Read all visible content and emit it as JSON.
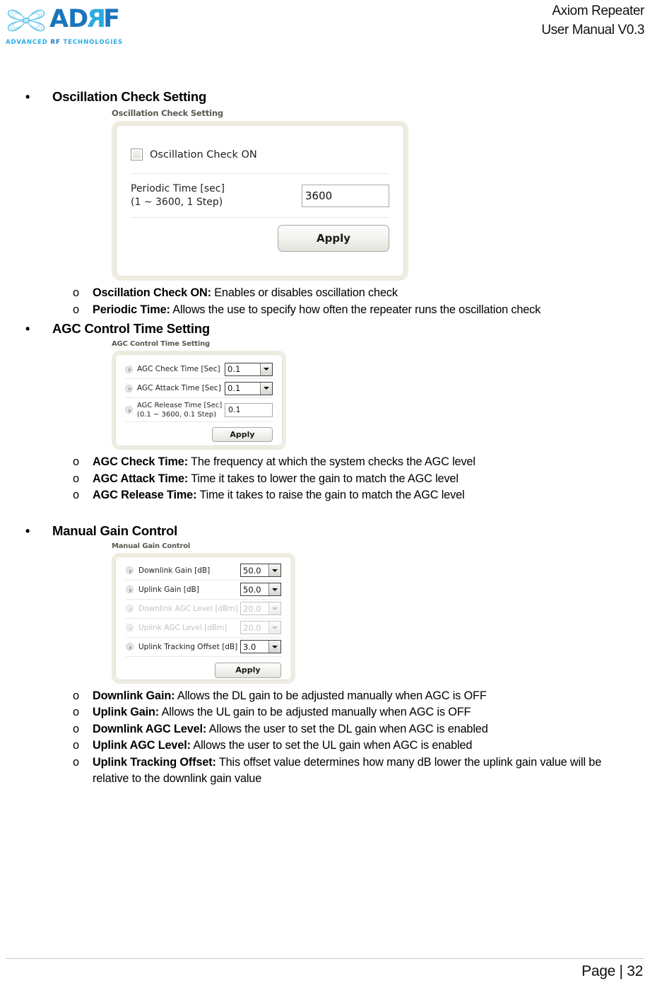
{
  "header": {
    "logo_word_1": "AD",
    "logo_word_r": "R",
    "logo_word_f": "F",
    "logo_tagline_1": "ADVANCED ",
    "logo_tagline_rf": "RF",
    "logo_tagline_2": " TECHNOLOGIES",
    "title_line1": "Axiom Repeater",
    "title_line2": "User Manual V0.3"
  },
  "sections": [
    {
      "heading": "Oscillation Check Setting",
      "bullet": "•",
      "panel": {
        "title": "Oscillation Check Setting",
        "checkbox_label": "Oscillation Check ON",
        "field_label_line1": "Periodic Time [sec]",
        "field_label_line2": "(1 ~ 3600, 1 Step)",
        "field_value": "3600",
        "apply_label": "Apply"
      },
      "items": [
        {
          "marker": "o",
          "term": "Oscillation Check ON:",
          "desc": " Enables or disables oscillation check"
        },
        {
          "marker": "o",
          "term": "Periodic Time:",
          "desc": " Allows the use to specify how often the repeater runs the oscillation check"
        }
      ]
    },
    {
      "heading": "AGC Control Time Setting",
      "bullet": "•",
      "panel": {
        "title": "AGC Control Time Setting",
        "rows": [
          {
            "label": "AGC Check Time [Sec]",
            "value": "0.1",
            "control": "select",
            "disabled": false
          },
          {
            "label": "AGC Attack Time [Sec]",
            "value": "0.1",
            "control": "select",
            "disabled": false
          },
          {
            "label_line1": "AGC Release Time [Sec]",
            "label_line2": "(0.1 ~ 3600, 0.1 Step)",
            "value": "0.1",
            "control": "input",
            "disabled": false
          }
        ],
        "apply_label": "Apply"
      },
      "items": [
        {
          "marker": "o",
          "term": "AGC Check Time:",
          "desc": " The frequency at which the system checks the AGC level"
        },
        {
          "marker": "o",
          "term": "AGC Attack Time:",
          "desc": " Time it takes to lower the gain to match the AGC level"
        },
        {
          "marker": "o",
          "term": "AGC Release Time:",
          "desc": " Time it takes to raise the gain to match the AGC level"
        }
      ]
    },
    {
      "heading": "Manual Gain Control",
      "bullet": "•",
      "panel": {
        "title": "Manual Gain Control",
        "rows": [
          {
            "label": "Downlink Gain [dB]",
            "value": "50.0",
            "control": "select",
            "disabled": false
          },
          {
            "label": "Uplink Gain [dB]",
            "value": "50.0",
            "control": "select",
            "disabled": false
          },
          {
            "label": "Downlink AGC Level [dBm]",
            "value": "20.0",
            "control": "select",
            "disabled": true
          },
          {
            "label": "Uplink AGC Level [dBm]",
            "value": "20.0",
            "control": "select",
            "disabled": true
          },
          {
            "label": "Uplink Tracking Offset [dB]",
            "value": "3.0",
            "control": "select",
            "disabled": false
          }
        ],
        "apply_label": "Apply"
      },
      "items": [
        {
          "marker": "o",
          "term": "Downlink Gain:",
          "desc": " Allows the DL gain to be adjusted manually when AGC is OFF"
        },
        {
          "marker": "o",
          "term": "Uplink Gain:",
          "desc": " Allows the UL gain to be adjusted manually when AGC is OFF"
        },
        {
          "marker": "o",
          "term": "Downlink AGC Level:",
          "desc": " Allows the user to set the DL gain when AGC is enabled"
        },
        {
          "marker": "o",
          "term": "Uplink AGC Level:",
          "desc": " Allows the user to set the UL gain when AGC is enabled"
        },
        {
          "marker": "o",
          "term": "Uplink Tracking Offset:",
          "desc": " This offset value determines how many dB lower the uplink gain value will be relative to the downlink gain value"
        }
      ]
    }
  ],
  "footer": {
    "page_label": "Page | 32"
  }
}
